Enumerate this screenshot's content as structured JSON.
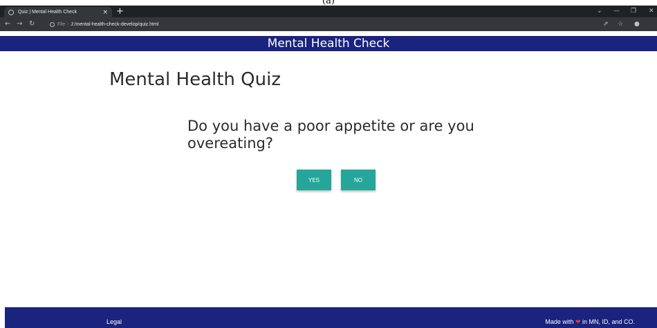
{
  "caption": "(a)",
  "browser": {
    "tab_title": "Quiz | Mental Health Check",
    "tab_close": "×",
    "new_tab": "+",
    "address_label": "File",
    "address_url": "J:/mental-health-check-develop/quiz.html"
  },
  "header": {
    "title": "Mental Health Check"
  },
  "quiz": {
    "title": "Mental Health Quiz",
    "question": "Do you have a poor appetite or are you overeating?",
    "yes_label": "YES",
    "no_label": "NO",
    "button_color": "#26a69a"
  },
  "footer": {
    "legal_label": "Legal",
    "made_with_prefix": "Made with",
    "made_with_suffix": "in MN, ID, and CO.",
    "heart_icon": "heart-icon"
  },
  "colors": {
    "brand": "#1a237e",
    "accent": "#26a69a",
    "heart": "#e53935"
  }
}
